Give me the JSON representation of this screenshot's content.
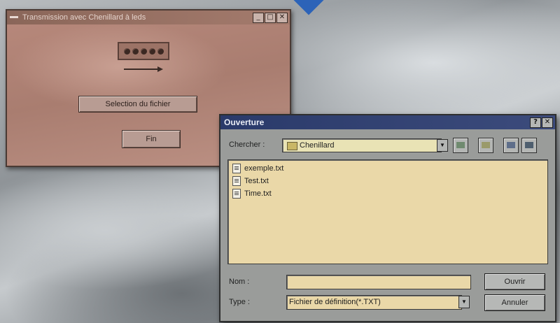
{
  "window1": {
    "title": "Transmission avec Chenillard à leds",
    "buttons": {
      "select_file": "Selection du fichier",
      "fin": "Fin"
    },
    "title_buttons": [
      "_",
      "□",
      "✕"
    ]
  },
  "dialog": {
    "title": "Ouverture",
    "title_buttons": [
      "?",
      "✕"
    ],
    "look_in_label": "Chercher :",
    "look_in_value": "Chenillard",
    "files": [
      {
        "name": "exemple.txt"
      },
      {
        "name": "Test.txt"
      },
      {
        "name": "Time.txt"
      }
    ],
    "name_label": "Nom :",
    "name_value": "",
    "type_label": "Type :",
    "type_value": "Fichier de définition(*.TXT)",
    "open_button": "Ouvrir",
    "cancel_button": "Annuler"
  },
  "colors": {
    "window1_bg": "#b08376",
    "dialog_titlebar": "#2a3a6a",
    "list_bg": "#ead8a8",
    "accent_diamond": "#2c63b8"
  }
}
